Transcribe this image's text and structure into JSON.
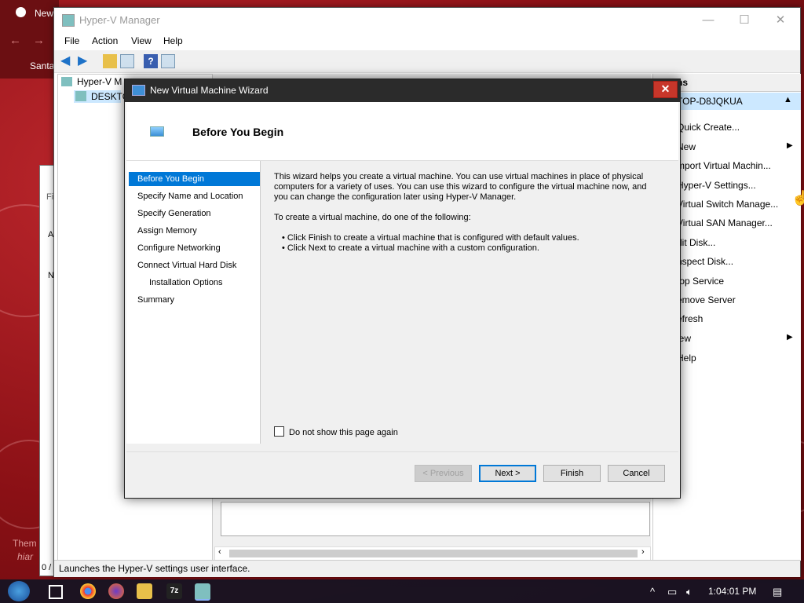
{
  "background": {
    "browser_tab": "New",
    "browser_bookmark": "Santa",
    "theme_text": "Them",
    "ghost_text": "hiar"
  },
  "hyperv": {
    "title": "Hyper-V Manager",
    "menu": [
      "File",
      "Action",
      "View",
      "Help"
    ],
    "tree": {
      "root": "Hyper-V M",
      "server": "DESKTO"
    },
    "actions": {
      "header": "ns",
      "server": "TOP-D8JQKUA",
      "items": [
        "Quick Create...",
        "New",
        "mport Virtual Machin...",
        "Hyper-V Settings...",
        "Virtual Switch Manage...",
        "Virtual SAN Manager...",
        "dit Disk...",
        "nspect Disk...",
        "top Service",
        "emove Server",
        "efresh",
        "iew",
        "Help"
      ]
    },
    "status": "Launches the Hyper-V settings user interface.",
    "left_status": "0 /",
    "left_labels": [
      "Fi",
      "A",
      "N"
    ]
  },
  "wizard": {
    "title": "New Virtual Machine Wizard",
    "close_label": "✕",
    "heading": "Before You Begin",
    "nav": [
      "Before You Begin",
      "Specify Name and Location",
      "Specify Generation",
      "Assign Memory",
      "Configure Networking",
      "Connect Virtual Hard Disk",
      "Installation Options",
      "Summary"
    ],
    "body": {
      "intro": "This wizard helps you create a virtual machine. You can use virtual machines in place of physical computers for a variety of uses. You can use this wizard to configure the virtual machine now, and you can change the configuration later using Hyper-V Manager.",
      "instruction": "To create a virtual machine, do one of the following:",
      "bullets": [
        "Click Finish to create a virtual machine that is configured with default values.",
        "Click Next to create a virtual machine with a custom configuration."
      ]
    },
    "checkbox": "Do not show this page again",
    "buttons": {
      "previous": "< Previous",
      "next": "Next >",
      "finish": "Finish",
      "cancel": "Cancel"
    }
  },
  "taskbar": {
    "time": "1:04:01 PM"
  },
  "colors": {
    "selection": "#0078d7",
    "close": "#c7362a",
    "wizard_titlebar": "#2b2b2b"
  }
}
